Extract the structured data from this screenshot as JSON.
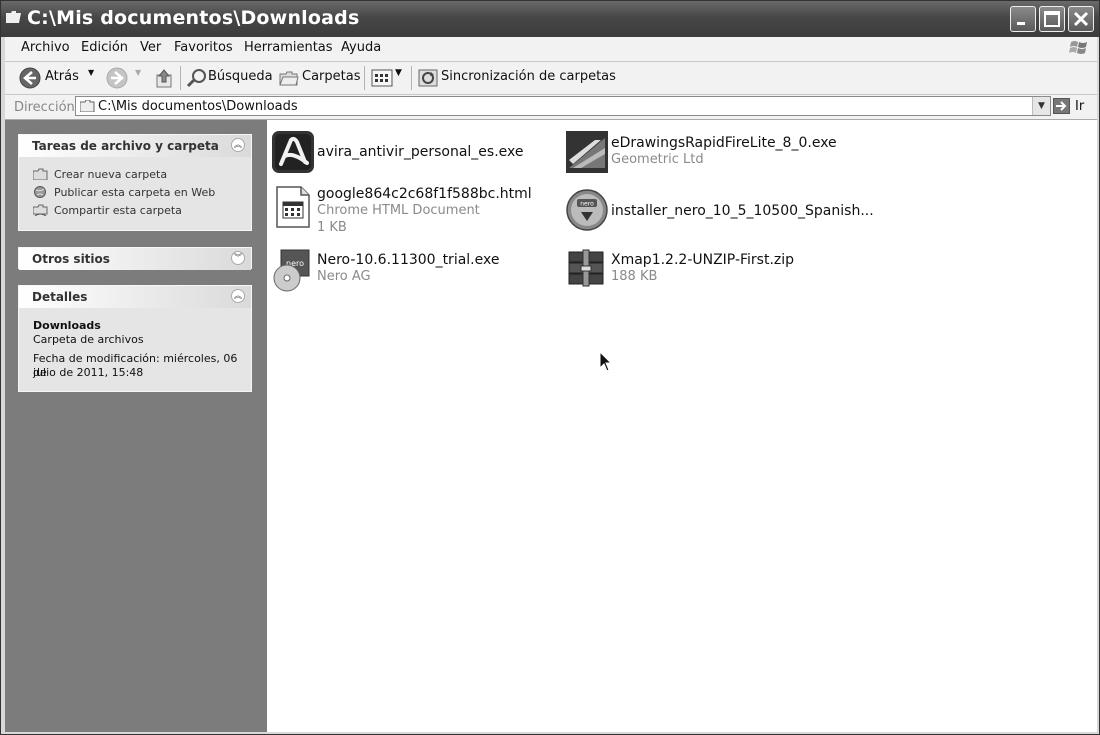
{
  "window": {
    "title": "C:\\Mis documentos\\Downloads"
  },
  "menu": [
    "Archivo",
    "Edición",
    "Ver",
    "Favoritos",
    "Herramientas",
    "Ayuda"
  ],
  "toolbar": {
    "back": "Atrás",
    "search": "Búsqueda",
    "folders": "Carpetas",
    "sync": "Sincronización de carpetas"
  },
  "address": {
    "label": "Dirección",
    "value": "C:\\Mis documentos\\Downloads",
    "go": "Ir"
  },
  "left_panel": {
    "tasks": {
      "title": "Tareas de archivo y carpeta",
      "items": [
        "Crear nueva carpeta",
        "Publicar esta carpeta en Web",
        "Compartir esta carpeta"
      ]
    },
    "other": {
      "title": "Otros sitios"
    },
    "details": {
      "title": "Detalles",
      "name": "Downloads",
      "type": "Carpeta de archivos",
      "modified_line1": "Fecha de modificación: miércoles, 06 de",
      "modified_line2": "julio de 2011, 15:48"
    }
  },
  "files": [
    {
      "name": "avira_antivir_personal_es.exe",
      "icon": "avira-icon"
    },
    {
      "name": "eDrawingsRapidFireLite_8_0.exe",
      "sub": "Geometric Ltd",
      "icon": "edrawings-icon"
    },
    {
      "name": "google864c2c68f1f588bc.html",
      "sub": "Chrome HTML Document",
      "sub2": "1 KB",
      "icon": "html-document-icon"
    },
    {
      "name": "installer_nero_10_5_10500_Spanish...",
      "icon": "nero-installer-icon"
    },
    {
      "name": "Nero-10.6.11300_trial.exe",
      "sub": "Nero AG",
      "icon": "nero-disc-icon"
    },
    {
      "name": "Xmap1.2.2-UNZIP-First.zip",
      "sub": "188 KB",
      "icon": "zip-archive-icon"
    }
  ]
}
